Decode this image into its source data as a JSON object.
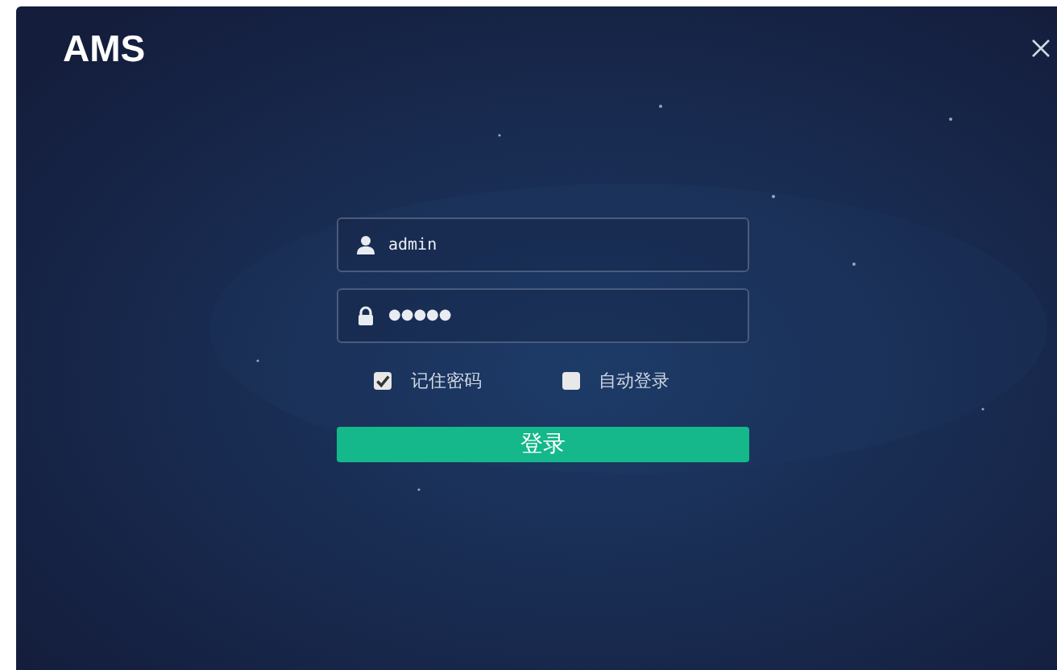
{
  "window": {
    "title": "AMS"
  },
  "fields": [
    {
      "kind": "user",
      "value": "admin"
    },
    {
      "kind": "password",
      "value": "●●●●●"
    }
  ],
  "options": [
    {
      "label": "记住密码",
      "checked": true
    },
    {
      "label": "自动登录",
      "checked": false
    }
  ],
  "button": {
    "label": "登录"
  }
}
